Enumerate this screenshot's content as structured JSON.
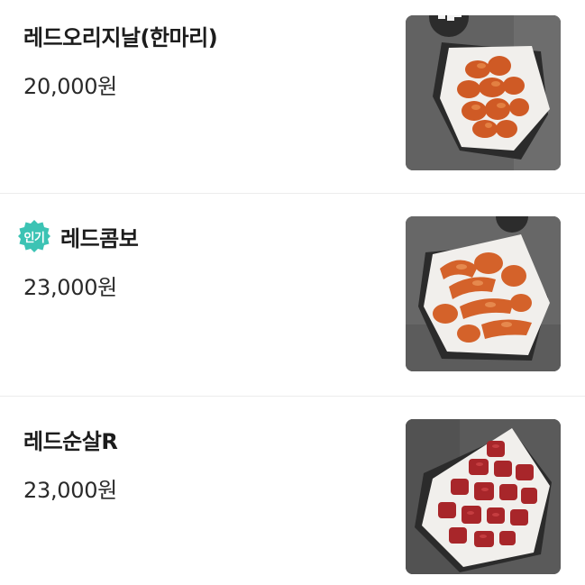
{
  "menu": {
    "items": [
      {
        "name": "레드오리지날(한마리)",
        "price": "20,000원",
        "badge": null,
        "image": "red-original-chicken-photo"
      },
      {
        "name": "레드콤보",
        "price": "23,000원",
        "badge": "인기",
        "image": "red-combo-chicken-photo"
      },
      {
        "name": "레드순살R",
        "price": "23,000원",
        "badge": null,
        "image": "red-boneless-chicken-photo"
      }
    ]
  },
  "colors": {
    "badge": "#3cc3b4",
    "divider": "#ececec",
    "text": "#1c1c1c",
    "photo_background": "#5f5f5f",
    "chicken_orange": "#d4622a",
    "chicken_red": "#a8262a"
  }
}
